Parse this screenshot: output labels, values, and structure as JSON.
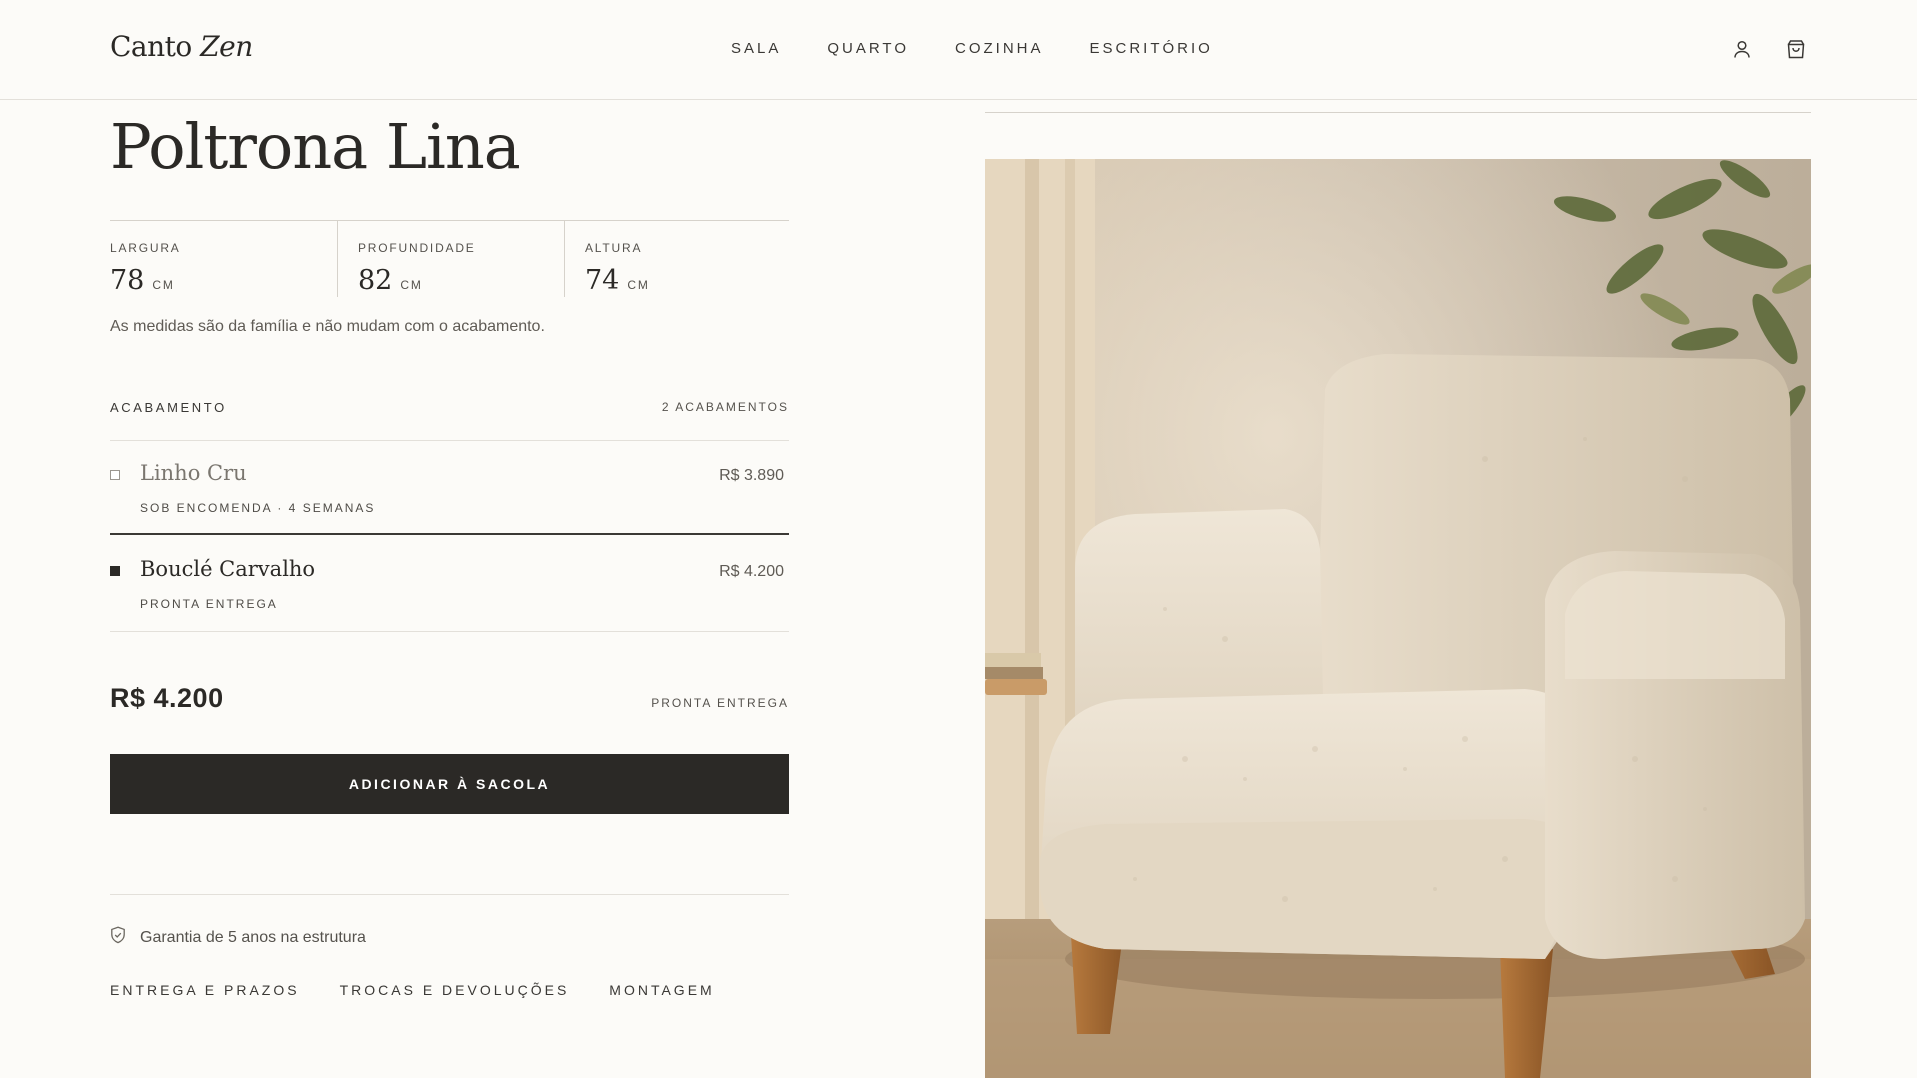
{
  "brand": {
    "name": "Canto",
    "name_italic": "Zen"
  },
  "nav": {
    "items": [
      "SALA",
      "QUARTO",
      "COZINHA",
      "ESCRITÓRIO"
    ]
  },
  "header_icons": [
    "user-icon",
    "shopping-bag-icon"
  ],
  "product": {
    "title": "Poltrona Lina",
    "dimensions": [
      {
        "label": "LARGURA",
        "value": "78",
        "unit": "CM"
      },
      {
        "label": "PROFUNDIDADE",
        "value": "82",
        "unit": "CM"
      },
      {
        "label": "ALTURA",
        "value": "74",
        "unit": "CM"
      }
    ],
    "dimensions_note": "As medidas são da família e não mudam com o acabamento."
  },
  "finish": {
    "label": "ACABAMENTO",
    "count": "2 ACABAMENTOS",
    "options": [
      {
        "name": "Linho Cru",
        "sub": "SOB ENCOMENDA · 4 SEMANAS",
        "price": "R$ 3.890",
        "selected": false
      },
      {
        "name": "Bouclé Carvalho",
        "sub": "PRONTA ENTREGA",
        "price": "R$ 4.200",
        "selected": true
      }
    ]
  },
  "purchase": {
    "price": "R$ 4.200",
    "availability": "PRONTA ENTREGA",
    "add_button": "ADICIONAR À SACOLA"
  },
  "warranty": {
    "text": "Garantia de 5 anos na estrutura",
    "icon": "shield-icon"
  },
  "info_links": [
    "ENTREGA E PRAZOS",
    "TROCAS E DEVOLUÇÕES",
    "MONTAGEM"
  ],
  "colors": {
    "text": "#2b2926",
    "background": "#fcfbf8",
    "button": "#2b2926",
    "rule": "#e3e0da"
  }
}
